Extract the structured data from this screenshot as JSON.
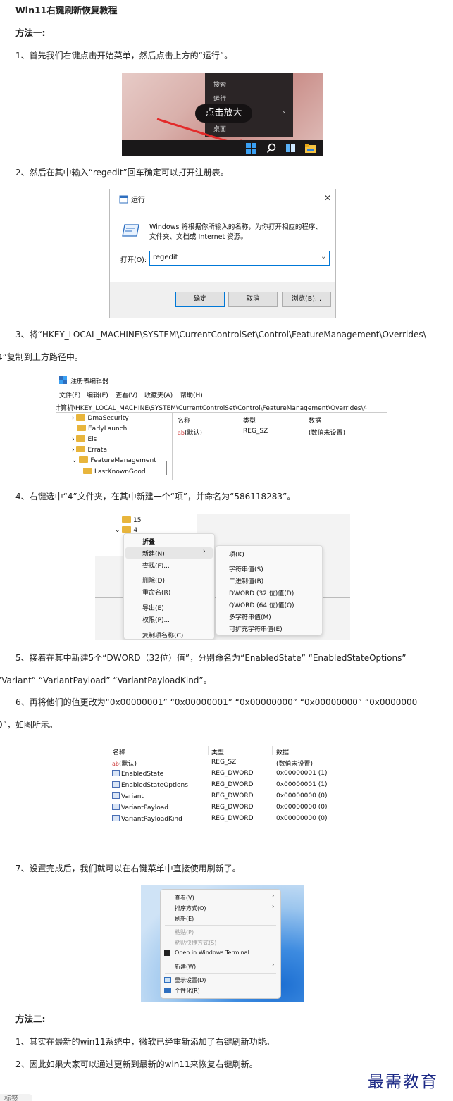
{
  "title": "Win11右键刷新恢复教程",
  "method1": "方法一:",
  "step1": "1、首先我们右键点击开始菜单，然后点击上方的“运行”。",
  "img1": {
    "menu_items": [
      "搜索",
      "运行",
      "桌面"
    ],
    "tooltip": "点击放大"
  },
  "step2": "2、然后在其中输入“regedit”回车确定可以打开注册表。",
  "img2": {
    "window_title": "运行",
    "close": "✕",
    "desc_line1": "Windows 将根据你所输入的名称，为你打开相应的程序、",
    "desc_line2": "文件夹、文档或 Internet 资源。",
    "open_label": "打开(O):",
    "input_value": "regedit",
    "btn_ok": "确定",
    "btn_cancel": "取消",
    "btn_browse": "浏览(B)..."
  },
  "step3_line1": "3、将“HKEY_LOCAL_MACHINE\\SYSTEM\\CurrentControlSet\\Control\\FeatureManagement\\Overrides\\",
  "step3_line2": "4”复制到上方路径中。",
  "img3": {
    "app_title": "注册表编辑器",
    "menu": [
      "文件(F)",
      "编辑(E)",
      "查看(V)",
      "收藏夹(A)",
      "帮助(H)"
    ],
    "path": "计算机\\HKEY_LOCAL_MACHINE\\SYSTEM\\CurrentControlSet\\Control\\FeatureManagement\\Overrides\\4",
    "tree": [
      "DmaSecurity",
      "EarlyLaunch",
      "Els",
      "Errata",
      "FeatureManagement",
      "LastKnownGood"
    ],
    "col_name": "名称",
    "col_type": "类型",
    "col_data": "数据",
    "row_name": "(默认)",
    "row_type": "REG_SZ",
    "row_data": "(数值未设置)"
  },
  "step4": "4、右键选中“4”文件夹，在其中新建一个“项”，并命名为“586118283”。",
  "img4": {
    "tree": [
      "15",
      "4"
    ],
    "menu1": [
      "折叠",
      "新建(N)",
      "查找(F)...",
      "删除(D)",
      "重命名(R)",
      "导出(E)",
      "权限(P)...",
      "复制项名称(C)"
    ],
    "menu2": [
      "项(K)",
      "字符串值(S)",
      "二进制值(B)",
      "DWORD (32 位)值(D)",
      "QWORD (64 位)值(Q)",
      "多字符串值(M)",
      "可扩充字符串值(E)"
    ]
  },
  "step5_line1": "5、接着在其中新建5个“DWORD（32位）值”，分别命名为“EnabledState” “EnabledStateOptions”",
  "step5_line2": "“Variant” “VariantPayload” “VariantPayloadKind”。",
  "step6_line1": "6、再将他们的值更改为“0x00000001” “0x00000001” “0x00000000” “0x00000000” “0x0000000",
  "step6_line2": "0”，如图所示。",
  "img5": {
    "col_name": "名称",
    "col_type": "类型",
    "col_data": "数据",
    "rows": [
      {
        "name": "(默认)",
        "type": "REG_SZ",
        "data": "(数值未设置)"
      },
      {
        "name": "EnabledState",
        "type": "REG_DWORD",
        "data": "0x00000001 (1)"
      },
      {
        "name": "EnabledStateOptions",
        "type": "REG_DWORD",
        "data": "0x00000001 (1)"
      },
      {
        "name": "Variant",
        "type": "REG_DWORD",
        "data": "0x00000000 (0)"
      },
      {
        "name": "VariantPayload",
        "type": "REG_DWORD",
        "data": "0x00000000 (0)"
      },
      {
        "name": "VariantPayloadKind",
        "type": "REG_DWORD",
        "data": "0x00000000 (0)"
      }
    ]
  },
  "step7": "7、设置完成后，我们就可以在右键菜单中直接使用刷新了。",
  "img6": {
    "items": [
      "查看(V)",
      "排序方式(O)",
      "刷新(E)",
      "粘贴(P)",
      "粘贴快捷方式(S)",
      "Open in Windows Terminal",
      "新建(W)",
      "显示设置(D)",
      "个性化(R)"
    ]
  },
  "method2": "方法二:",
  "m2_step1": "1、其实在最新的win11系统中，微软已经重新添加了右键刷新功能。",
  "m2_step2": "2、因此如果大家可以通过更新到最新的win11来恢复右键刷新。",
  "watermark": "最需教育",
  "footer_tag": "标签"
}
